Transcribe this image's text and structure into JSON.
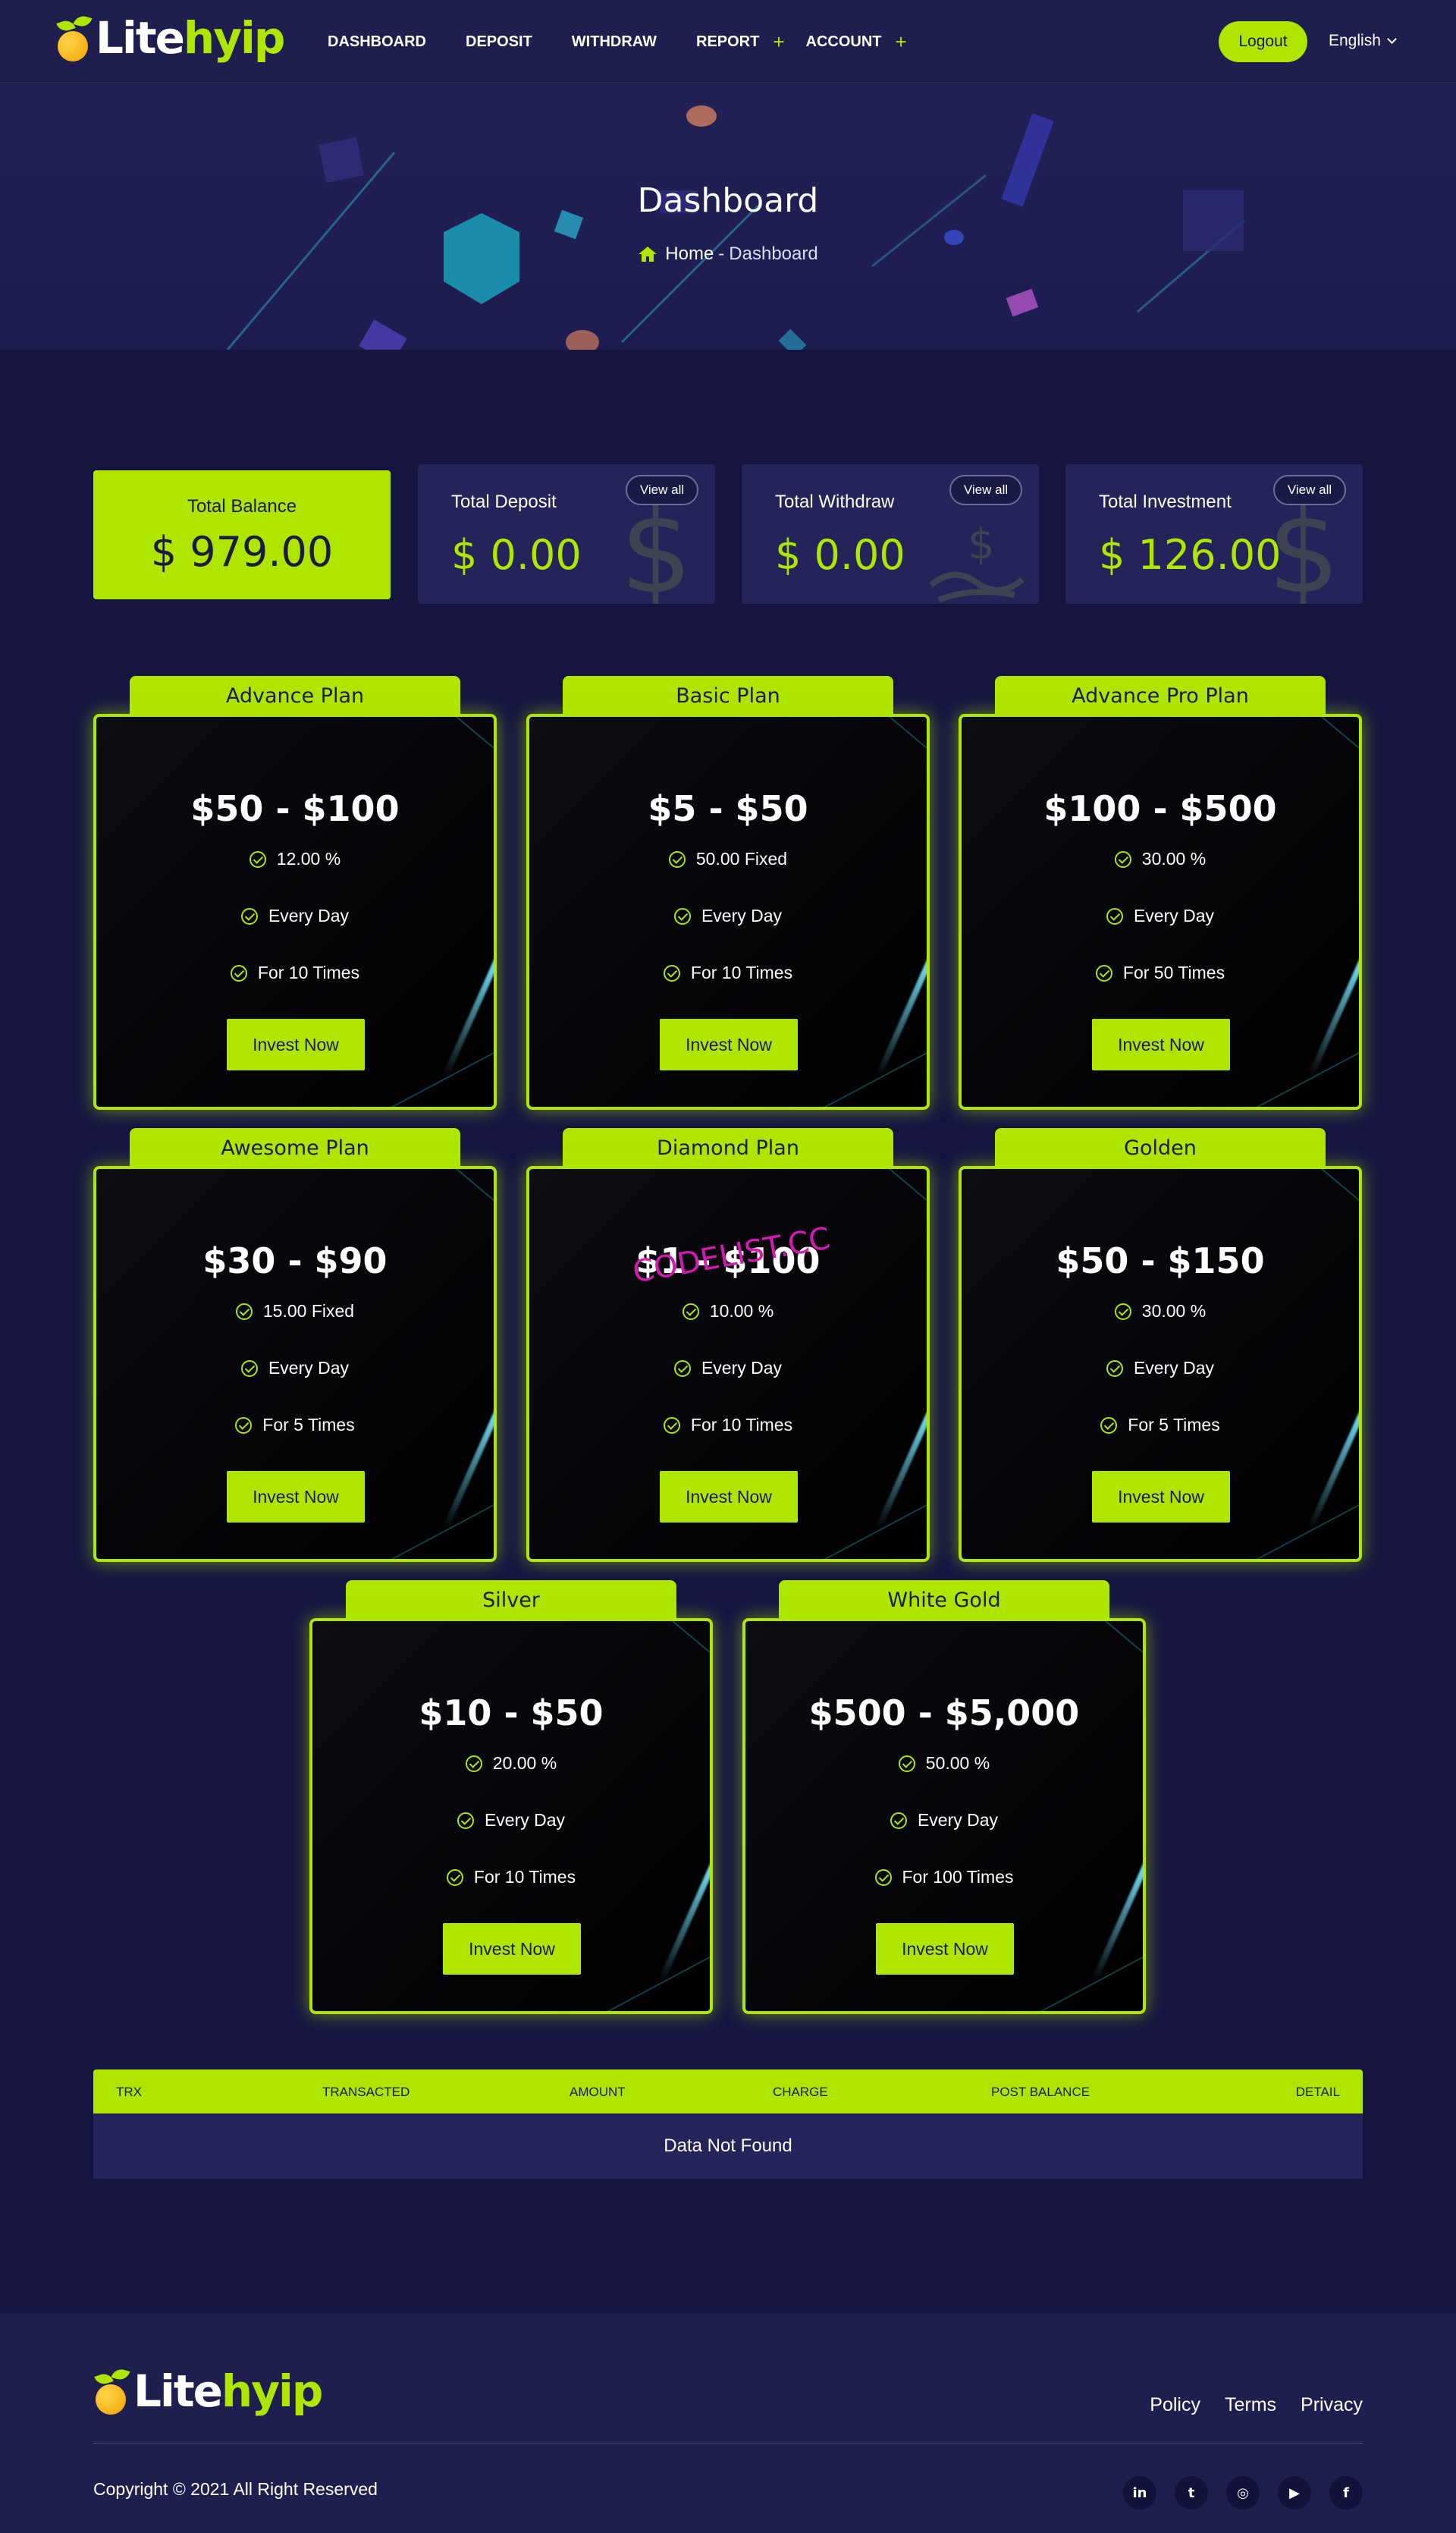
{
  "brand": {
    "part1": "Lite",
    "part2": "hyip"
  },
  "nav": {
    "items": [
      {
        "label": "DASHBOARD",
        "plus": ""
      },
      {
        "label": "DEPOSIT",
        "plus": ""
      },
      {
        "label": "WITHDRAW",
        "plus": ""
      },
      {
        "label": "REPORT",
        "plus": "+"
      },
      {
        "label": "ACCOUNT",
        "plus": "+"
      }
    ],
    "logout": "Logout",
    "language": "English"
  },
  "banner": {
    "title": "Dashboard",
    "breadcrumb_home": "Home",
    "breadcrumb_sep": "-",
    "breadcrumb_current": "Dashboard"
  },
  "stats": {
    "balance": {
      "label": "Total Balance",
      "value": "$ 979.00"
    },
    "deposit": {
      "label": "Total Deposit",
      "value": "$ 0.00",
      "view_all": "View all"
    },
    "withdraw": {
      "label": "Total Withdraw",
      "value": "$ 0.00",
      "view_all": "View all"
    },
    "investment": {
      "label": "Total Investment",
      "value": "$ 126.00",
      "view_all": "View all"
    }
  },
  "plans": [
    {
      "name": "Advance Plan",
      "range": "$50 - $100",
      "interest": "12.00 %",
      "period": "Every Day",
      "times": "For 10 Times",
      "button": "Invest Now"
    },
    {
      "name": "Basic Plan",
      "range": "$5 - $50",
      "interest": "50.00 Fixed",
      "period": "Every Day",
      "times": "For 10 Times",
      "button": "Invest Now"
    },
    {
      "name": "Advance Pro Plan",
      "range": "$100 - $500",
      "interest": "30.00 %",
      "period": "Every Day",
      "times": "For 50 Times",
      "button": "Invest Now"
    },
    {
      "name": "Awesome Plan",
      "range": "$30 - $90",
      "interest": "15.00 Fixed",
      "period": "Every Day",
      "times": "For 5 Times",
      "button": "Invest Now"
    },
    {
      "name": "Diamond Plan",
      "range": "$1 - $100",
      "interest": "10.00 %",
      "period": "Every Day",
      "times": "For 10 Times",
      "button": "Invest Now"
    },
    {
      "name": "Golden",
      "range": "$50 - $150",
      "interest": "30.00 %",
      "period": "Every Day",
      "times": "For 5 Times",
      "button": "Invest Now"
    },
    {
      "name": "Silver",
      "range": "$10 - $50",
      "interest": "20.00 %",
      "period": "Every Day",
      "times": "For 10 Times",
      "button": "Invest Now"
    },
    {
      "name": "White Gold",
      "range": "$500 - $5,000",
      "interest": "50.00 %",
      "period": "Every Day",
      "times": "For 100 Times",
      "button": "Invest Now"
    }
  ],
  "watermark": "CODELIST.CC",
  "table": {
    "headers": [
      "TRX",
      "TRANSACTED",
      "AMOUNT",
      "CHARGE",
      "POST BALANCE",
      "DETAIL"
    ],
    "empty_text": "Data Not Found"
  },
  "footer": {
    "links": [
      "Policy",
      "Terms",
      "Privacy"
    ],
    "copyright": "Copyright © 2021 All Right Reserved",
    "socials": [
      {
        "icon": "linkedin-icon",
        "glyph": "in"
      },
      {
        "icon": "twitter-icon",
        "glyph": "t"
      },
      {
        "icon": "instagram-icon",
        "glyph": "◎"
      },
      {
        "icon": "youtube-icon",
        "glyph": "▶"
      },
      {
        "icon": "facebook-icon",
        "glyph": "f"
      }
    ]
  },
  "colors": {
    "accent": "#aee600",
    "background": "#151540",
    "surface": "#24245a"
  }
}
